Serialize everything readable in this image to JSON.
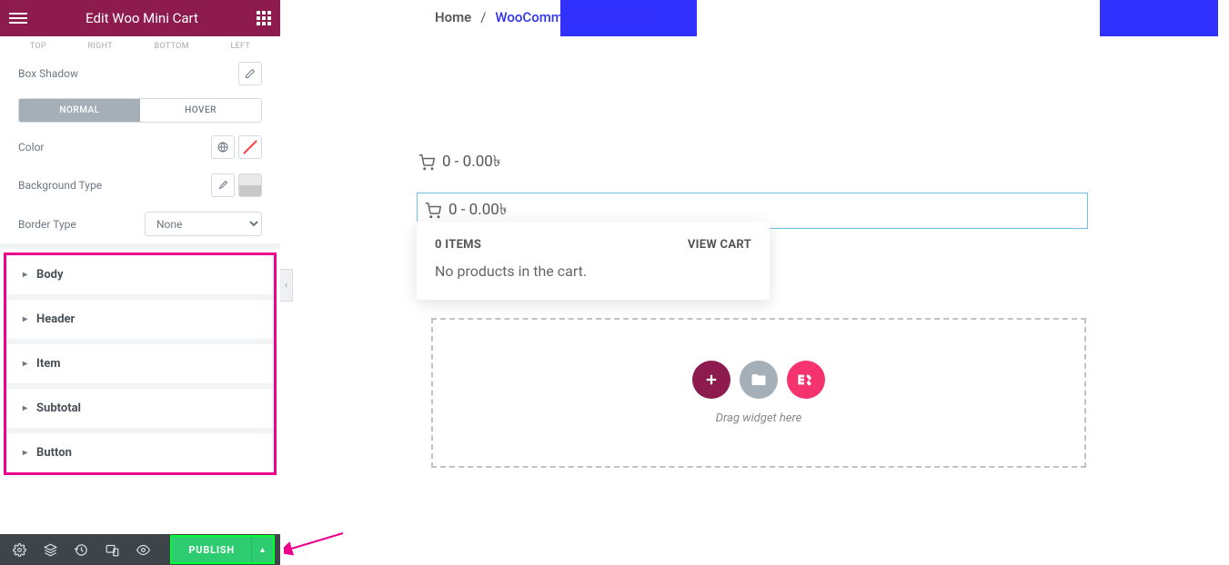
{
  "header": {
    "title": "Edit Woo Mini Cart"
  },
  "spacing_labels": [
    "TOP",
    "RIGHT",
    "BOTTOM",
    "LEFT"
  ],
  "controls": {
    "box_shadow": "Box Shadow",
    "tabs": {
      "normal": "NORMAL",
      "hover": "HOVER"
    },
    "color": "Color",
    "bg_type": "Background Type",
    "border_type": "Border Type",
    "border_value": "None"
  },
  "sections": [
    "Body",
    "Header",
    "Item",
    "Subtotal",
    "Button"
  ],
  "footer": {
    "publish": "PUBLISH"
  },
  "breadcrumb": {
    "home": "Home",
    "sep": "/",
    "current": "WooCommerce Mini Cart"
  },
  "cart": {
    "count_price": "0 - 0.00৳",
    "items_label": "0 ITEMS",
    "view_cart": "VIEW CART",
    "empty": "No products in the cart."
  },
  "dropzone": {
    "drag_text": "Drag widget here",
    "ek": "E<"
  }
}
